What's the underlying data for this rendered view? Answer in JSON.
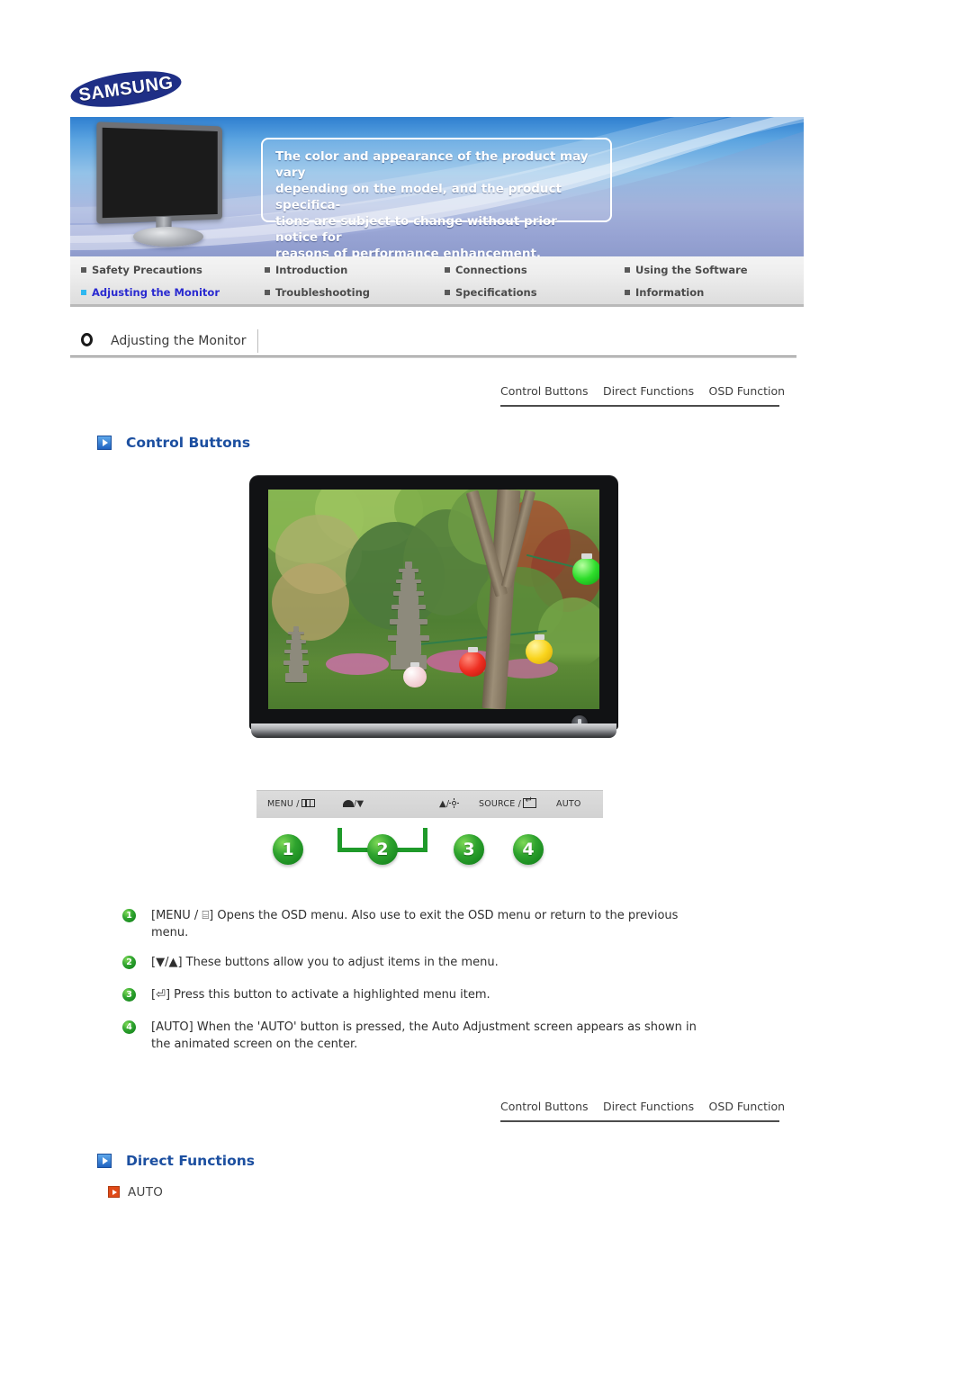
{
  "brand": {
    "logo_text": "SAMSUNG"
  },
  "banner": {
    "note_lines": [
      "The color and appearance of the product may vary",
      "depending on the model, and the product specifica-",
      "tions are subject to change without prior notice for",
      "reasons of performance enhancement."
    ],
    "monitor_icon": "monitor-illustration"
  },
  "nav": {
    "row1": [
      {
        "label": "Safety Precautions",
        "active": false
      },
      {
        "label": "Introduction",
        "active": false
      },
      {
        "label": "Connections",
        "active": false
      },
      {
        "label": "Using the Software",
        "active": false
      }
    ],
    "row2": [
      {
        "label": "Adjusting the Monitor",
        "active": true
      },
      {
        "label": "Troubleshooting",
        "active": false
      },
      {
        "label": "Specifications",
        "active": false
      },
      {
        "label": "Information",
        "active": false
      }
    ]
  },
  "section": {
    "title": "Adjusting the Monitor"
  },
  "tabs": [
    "Control Buttons",
    "Direct Functions",
    "OSD Function"
  ],
  "headings": {
    "control_buttons": "Control Buttons",
    "direct_functions": "Direct Functions"
  },
  "direct_function_items": [
    "AUTO"
  ],
  "control_strip": {
    "label_menu": "MENU /",
    "label_down": "/",
    "label_up": "/",
    "label_source": "SOURCE /",
    "label_auto": "AUTO",
    "icons": [
      "menu-icon",
      "contrast-icon",
      "down-triangle-icon",
      "up-triangle-icon",
      "brightness-sun-icon",
      "enter-icon"
    ]
  },
  "badges": [
    "1",
    "2",
    "3",
    "4"
  ],
  "descriptions": [
    {
      "num": "1",
      "text": "[MENU / ⌸] Opens the OSD menu. Also use to exit the OSD menu or return to the previous menu."
    },
    {
      "num": "2",
      "text": "[▼/▲] These buttons allow you to adjust items in the menu."
    },
    {
      "num": "3",
      "text": "[⏎] Press this button to activate a highlighted menu item."
    },
    {
      "num": "4",
      "text": "[AUTO] When the 'AUTO' button is pressed, the Auto Adjustment screen appears as shown in the animated screen on the center."
    }
  ],
  "monitor_photo": {
    "caption": "garden-scene-with-pagodas-and-lanterns",
    "power_button": "power-button"
  },
  "colors": {
    "nav_active": "#2a2ad0",
    "heading_blue": "#1c4fa0",
    "accent_orange": "#e04a18",
    "badge_green": "#2ea32e",
    "logo_navy": "#1f2f86"
  }
}
